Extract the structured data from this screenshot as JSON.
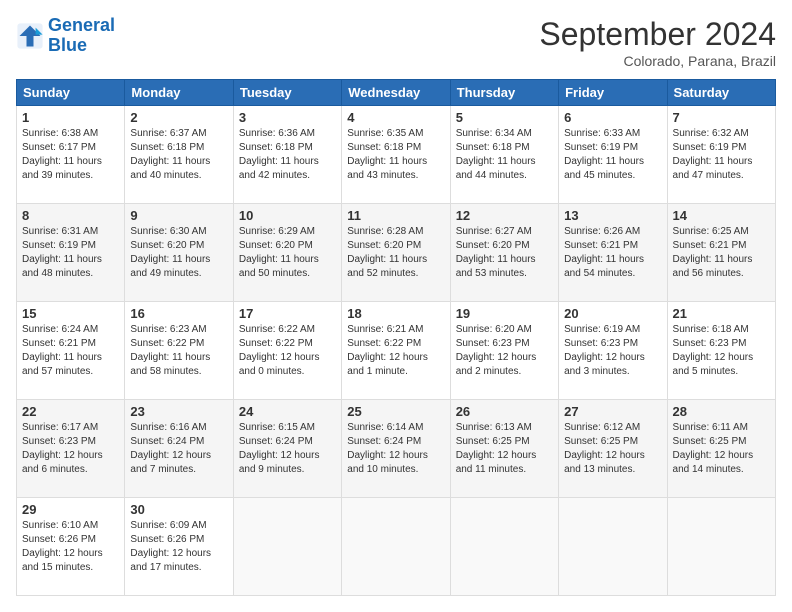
{
  "logo": {
    "line1": "General",
    "line2": "Blue"
  },
  "title": "September 2024",
  "subtitle": "Colorado, Parana, Brazil",
  "days_of_week": [
    "Sunday",
    "Monday",
    "Tuesday",
    "Wednesday",
    "Thursday",
    "Friday",
    "Saturday"
  ],
  "weeks": [
    [
      {
        "day": "1",
        "sunrise": "6:38 AM",
        "sunset": "6:17 PM",
        "daylight": "11 hours and 39 minutes."
      },
      {
        "day": "2",
        "sunrise": "6:37 AM",
        "sunset": "6:18 PM",
        "daylight": "11 hours and 40 minutes."
      },
      {
        "day": "3",
        "sunrise": "6:36 AM",
        "sunset": "6:18 PM",
        "daylight": "11 hours and 42 minutes."
      },
      {
        "day": "4",
        "sunrise": "6:35 AM",
        "sunset": "6:18 PM",
        "daylight": "11 hours and 43 minutes."
      },
      {
        "day": "5",
        "sunrise": "6:34 AM",
        "sunset": "6:18 PM",
        "daylight": "11 hours and 44 minutes."
      },
      {
        "day": "6",
        "sunrise": "6:33 AM",
        "sunset": "6:19 PM",
        "daylight": "11 hours and 45 minutes."
      },
      {
        "day": "7",
        "sunrise": "6:32 AM",
        "sunset": "6:19 PM",
        "daylight": "11 hours and 47 minutes."
      }
    ],
    [
      {
        "day": "8",
        "sunrise": "6:31 AM",
        "sunset": "6:19 PM",
        "daylight": "11 hours and 48 minutes."
      },
      {
        "day": "9",
        "sunrise": "6:30 AM",
        "sunset": "6:20 PM",
        "daylight": "11 hours and 49 minutes."
      },
      {
        "day": "10",
        "sunrise": "6:29 AM",
        "sunset": "6:20 PM",
        "daylight": "11 hours and 50 minutes."
      },
      {
        "day": "11",
        "sunrise": "6:28 AM",
        "sunset": "6:20 PM",
        "daylight": "11 hours and 52 minutes."
      },
      {
        "day": "12",
        "sunrise": "6:27 AM",
        "sunset": "6:20 PM",
        "daylight": "11 hours and 53 minutes."
      },
      {
        "day": "13",
        "sunrise": "6:26 AM",
        "sunset": "6:21 PM",
        "daylight": "11 hours and 54 minutes."
      },
      {
        "day": "14",
        "sunrise": "6:25 AM",
        "sunset": "6:21 PM",
        "daylight": "11 hours and 56 minutes."
      }
    ],
    [
      {
        "day": "15",
        "sunrise": "6:24 AM",
        "sunset": "6:21 PM",
        "daylight": "11 hours and 57 minutes."
      },
      {
        "day": "16",
        "sunrise": "6:23 AM",
        "sunset": "6:22 PM",
        "daylight": "11 hours and 58 minutes."
      },
      {
        "day": "17",
        "sunrise": "6:22 AM",
        "sunset": "6:22 PM",
        "daylight": "12 hours and 0 minutes."
      },
      {
        "day": "18",
        "sunrise": "6:21 AM",
        "sunset": "6:22 PM",
        "daylight": "12 hours and 1 minute."
      },
      {
        "day": "19",
        "sunrise": "6:20 AM",
        "sunset": "6:23 PM",
        "daylight": "12 hours and 2 minutes."
      },
      {
        "day": "20",
        "sunrise": "6:19 AM",
        "sunset": "6:23 PM",
        "daylight": "12 hours and 3 minutes."
      },
      {
        "day": "21",
        "sunrise": "6:18 AM",
        "sunset": "6:23 PM",
        "daylight": "12 hours and 5 minutes."
      }
    ],
    [
      {
        "day": "22",
        "sunrise": "6:17 AM",
        "sunset": "6:23 PM",
        "daylight": "12 hours and 6 minutes."
      },
      {
        "day": "23",
        "sunrise": "6:16 AM",
        "sunset": "6:24 PM",
        "daylight": "12 hours and 7 minutes."
      },
      {
        "day": "24",
        "sunrise": "6:15 AM",
        "sunset": "6:24 PM",
        "daylight": "12 hours and 9 minutes."
      },
      {
        "day": "25",
        "sunrise": "6:14 AM",
        "sunset": "6:24 PM",
        "daylight": "12 hours and 10 minutes."
      },
      {
        "day": "26",
        "sunrise": "6:13 AM",
        "sunset": "6:25 PM",
        "daylight": "12 hours and 11 minutes."
      },
      {
        "day": "27",
        "sunrise": "6:12 AM",
        "sunset": "6:25 PM",
        "daylight": "12 hours and 13 minutes."
      },
      {
        "day": "28",
        "sunrise": "6:11 AM",
        "sunset": "6:25 PM",
        "daylight": "12 hours and 14 minutes."
      }
    ],
    [
      {
        "day": "29",
        "sunrise": "6:10 AM",
        "sunset": "6:26 PM",
        "daylight": "12 hours and 15 minutes."
      },
      {
        "day": "30",
        "sunrise": "6:09 AM",
        "sunset": "6:26 PM",
        "daylight": "12 hours and 17 minutes."
      },
      null,
      null,
      null,
      null,
      null
    ]
  ]
}
